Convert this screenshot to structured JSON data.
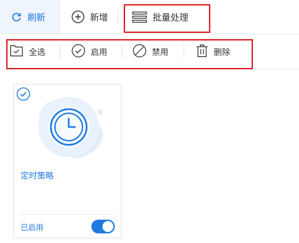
{
  "toolbar": {
    "refresh_label": "刷新",
    "add_label": "新增",
    "batch_label": "批量处理"
  },
  "batch_actions": {
    "select_all_label": "全选",
    "enable_label": "启用",
    "disable_label": "禁用",
    "delete_label": "删除"
  },
  "cards": [
    {
      "title": "定时策略",
      "status": "已启用",
      "enabled": true,
      "selected": true
    }
  ],
  "colors": {
    "accent": "#1f7ae0",
    "highlight_border": "#d9242b",
    "active_bg": "#eef5fd"
  }
}
